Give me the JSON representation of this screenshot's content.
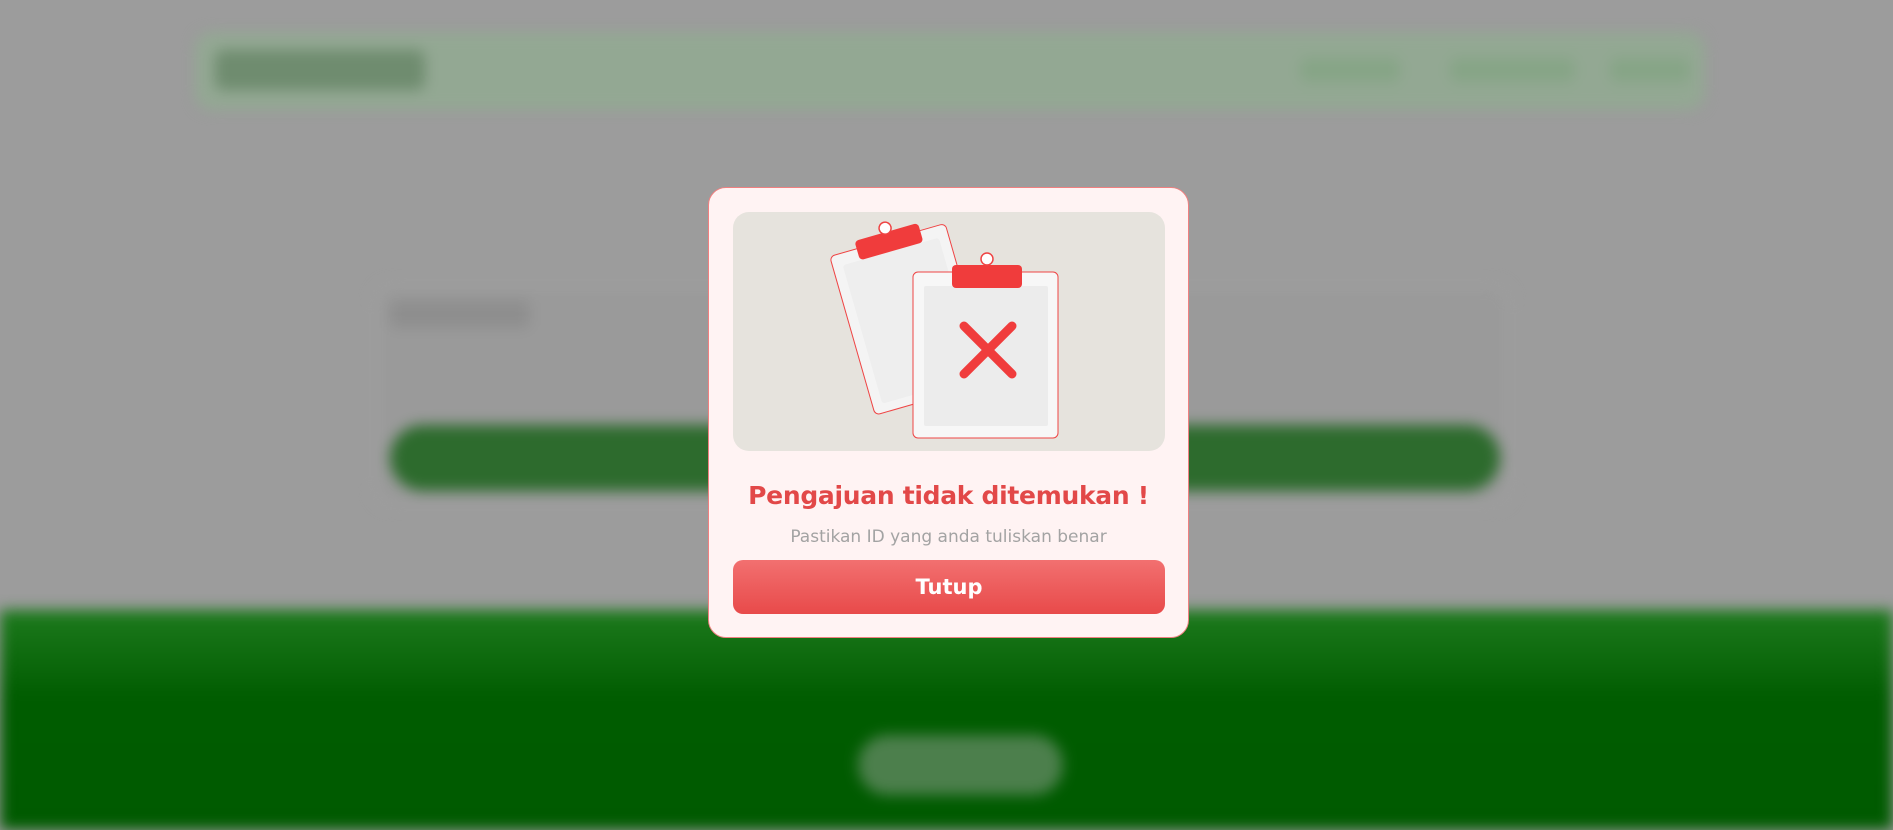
{
  "modal": {
    "title": "Pengajuan tidak ditemukan !",
    "message": "Pastikan ID yang anda tuliskan benar",
    "close_label": "Tutup",
    "illustration_icon": "clipboard-x-icon"
  },
  "colors": {
    "accent": "#e24848",
    "button": "#ee5a5a",
    "modal_bg": "#fff3f3",
    "overlay": "#9c9c9c",
    "footer": "#005c00"
  }
}
